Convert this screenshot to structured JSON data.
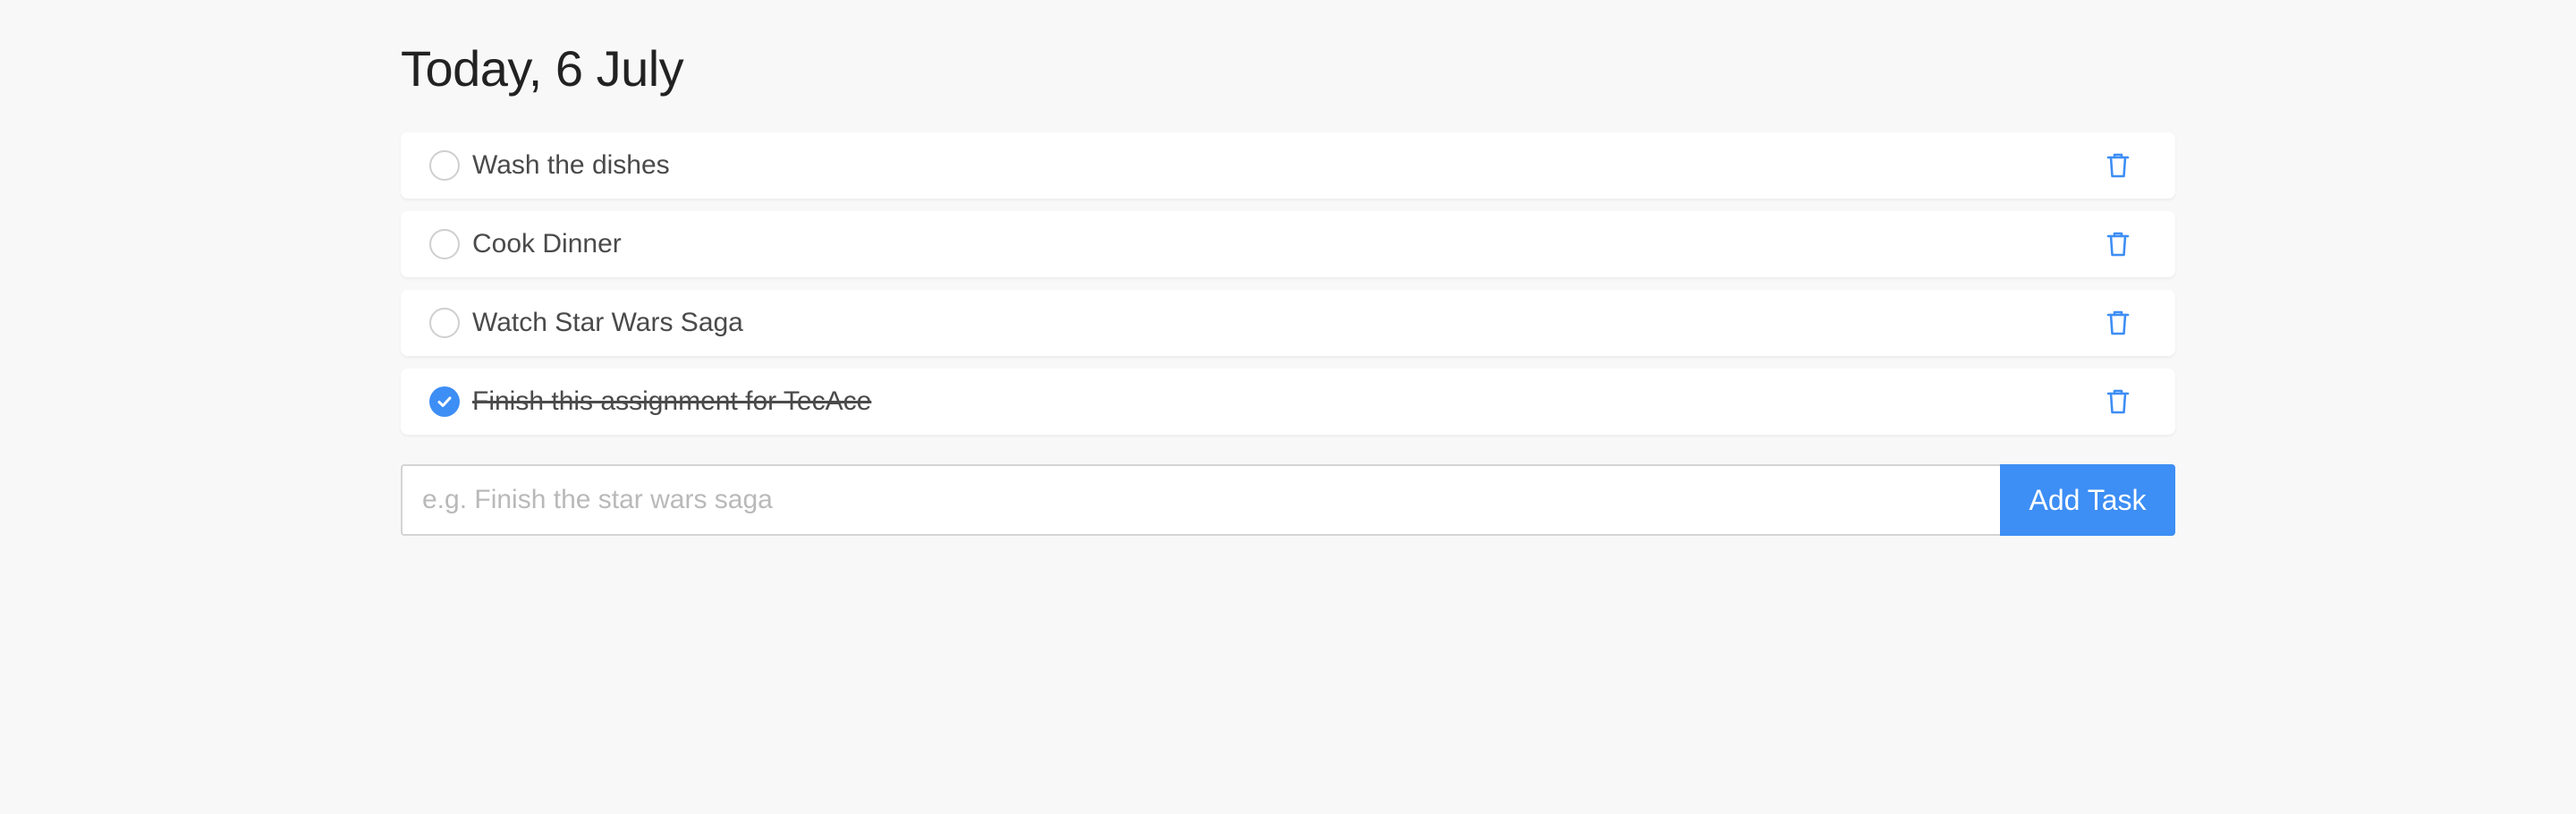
{
  "header": {
    "title": "Today, 6 July"
  },
  "tasks": [
    {
      "label": "Wash the dishes",
      "done": false,
      "check_icon": "circle-outline-icon",
      "delete_icon": "trash-icon"
    },
    {
      "label": "Cook Dinner",
      "done": false,
      "check_icon": "circle-outline-icon",
      "delete_icon": "trash-icon"
    },
    {
      "label": "Watch Star Wars Saga",
      "done": false,
      "check_icon": "circle-outline-icon",
      "delete_icon": "trash-icon"
    },
    {
      "label": "Finish this assignment for TecAce",
      "done": true,
      "check_icon": "check-circle-icon",
      "delete_icon": "trash-icon"
    }
  ],
  "add_task": {
    "input_value": "",
    "input_placeholder": "e.g. Finish the star wars saga",
    "button_label": "Add Task"
  },
  "colors": {
    "accent": "#3d8ef5",
    "background": "#f8f8f8",
    "card": "#ffffff",
    "text": "#4a4a4a",
    "placeholder": "#b9b9b9"
  }
}
